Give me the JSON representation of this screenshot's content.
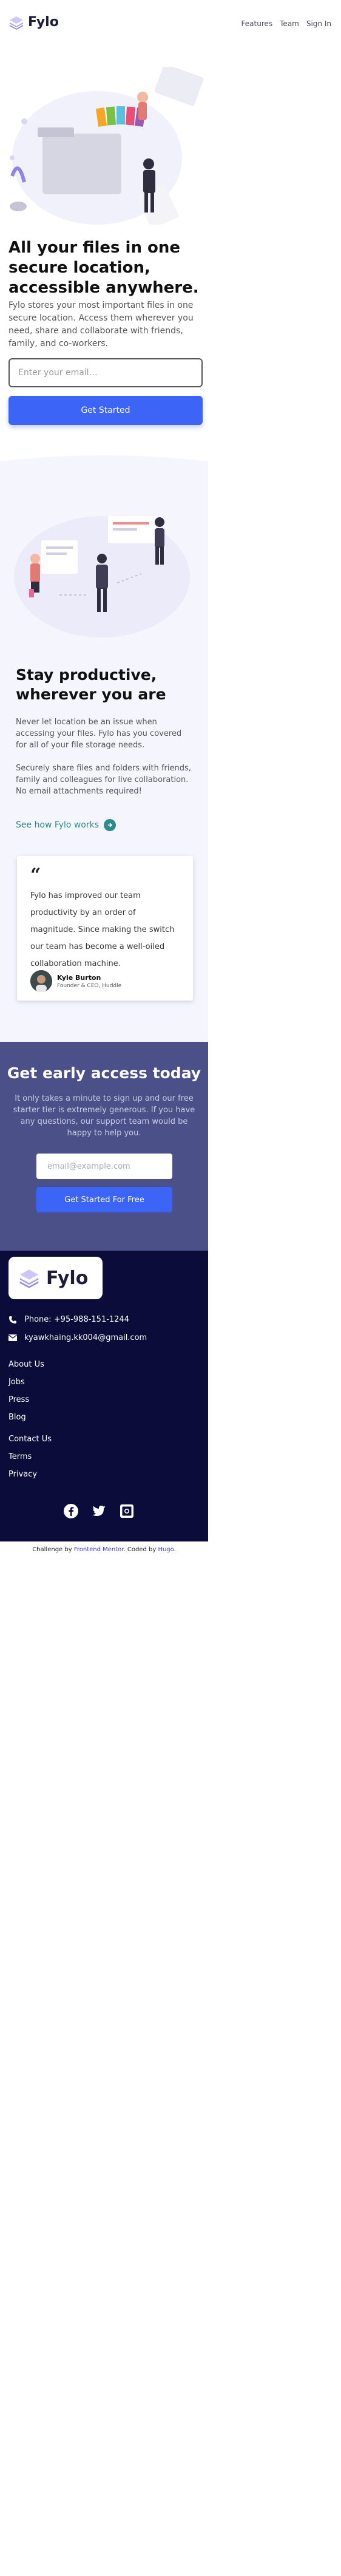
{
  "header": {
    "brand": "Fylo",
    "nav": [
      "Features",
      "Team",
      "Sign In"
    ]
  },
  "hero": {
    "title": "All your files in one secure location, accessible anywhere.",
    "text": "Fylo stores your most important files in one secure location. Access them wherever you need, share and collaborate with friends, family, and co-workers.",
    "email_placeholder": "Enter your email…",
    "button": "Get Started"
  },
  "productive": {
    "title": "Stay productive, wherever you are",
    "text1": "Never let location be an issue when accessing your files. Fylo has you covered for all of your file storage needs.",
    "text2": "Securely share files and folders with friends, family and colleagues for live collaboration. No email attachments required!",
    "link": "See how Fylo works"
  },
  "testimonial": {
    "quote_mark": "“",
    "quote": "Fylo has improved our team productivity by an order of magnitude. Since making the switch our team has become a well-oiled collaboration machine.",
    "name": "Kyle Burton",
    "role": "Founder & CEO, Huddle"
  },
  "early_access": {
    "title": "Get early access today",
    "text": "It only takes a minute to sign up and our free starter tier is extremely generous. If you have any questions, our support team would be happy to help you.",
    "email_placeholder": "email@example.com",
    "button": "Get Started For Free"
  },
  "footer": {
    "brand": "Fylo",
    "phone": "Phone: +95-988-151-1244",
    "email": "kyawkhaing.kk004@gmail.com",
    "links_group1": [
      "About Us",
      "Jobs",
      "Press",
      "Blog"
    ],
    "links_group2": [
      "Contact Us",
      "Terms",
      "Privacy"
    ],
    "social_icons": [
      "facebook-icon",
      "twitter-icon",
      "instagram-icon"
    ]
  },
  "attribution": {
    "prefix": "Challenge by ",
    "fm": "Frontend Mentor",
    "middle": ". Coded by ",
    "author": "Hugo",
    "suffix": "."
  },
  "colors": {
    "accent": "#3c64f6",
    "footer_bg": "#0c0c3a",
    "early_bg": "#4b5088",
    "link_teal": "#2e8b8b"
  }
}
